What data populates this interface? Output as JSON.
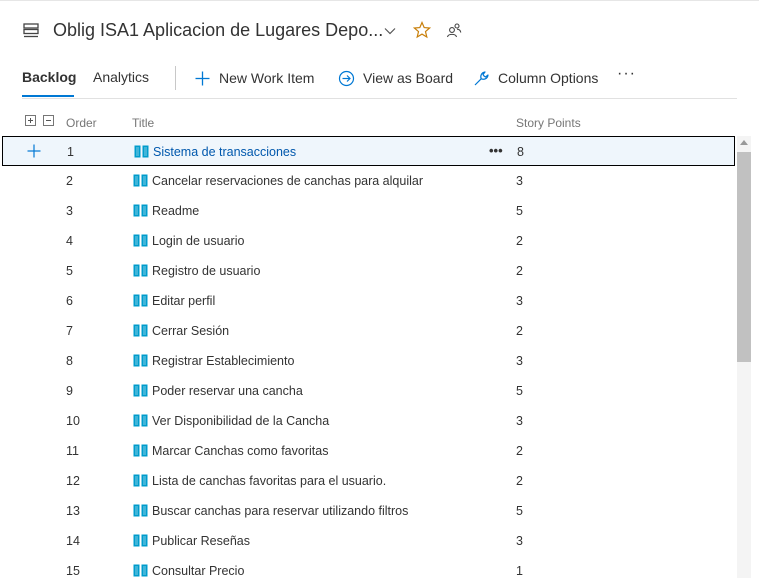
{
  "header": {
    "title": "Oblig ISA1 Aplicacion de Lugares Depo...",
    "icons": [
      "backlog-list-icon",
      "chevron-down-icon",
      "favorite-star-icon",
      "team-members-icon"
    ]
  },
  "toolbar": {
    "tabs": [
      {
        "label": "Backlog",
        "active": true
      },
      {
        "label": "Analytics",
        "active": false
      }
    ],
    "actions": [
      {
        "label": "New Work Item",
        "icon": "plus-icon"
      },
      {
        "label": "View as Board",
        "icon": "arrow-circle-icon"
      },
      {
        "label": "Column Options",
        "icon": "wrench-icon"
      }
    ],
    "more": "···"
  },
  "columns": {
    "order": "Order",
    "title": "Title",
    "points": "Story Points"
  },
  "rows": [
    {
      "order": "1",
      "title": "Sistema de transacciones",
      "points": "8",
      "selected": true
    },
    {
      "order": "2",
      "title": "Cancelar reservaciones de canchas para alquilar",
      "points": "3"
    },
    {
      "order": "3",
      "title": "Readme",
      "points": "5"
    },
    {
      "order": "4",
      "title": "Login de usuario",
      "points": "2"
    },
    {
      "order": "5",
      "title": "Registro de usuario",
      "points": "2"
    },
    {
      "order": "6",
      "title": "Editar perfil",
      "points": "3"
    },
    {
      "order": "7",
      "title": "Cerrar Sesión",
      "points": "2"
    },
    {
      "order": "8",
      "title": "Registrar Establecimiento",
      "points": "3"
    },
    {
      "order": "9",
      "title": "Poder reservar una cancha",
      "points": "5"
    },
    {
      "order": "10",
      "title": "Ver Disponibilidad de la Cancha",
      "points": "3"
    },
    {
      "order": "11",
      "title": "Marcar Canchas como favoritas",
      "points": "2"
    },
    {
      "order": "12",
      "title": "Lista de canchas favoritas para el usuario.",
      "points": "2"
    },
    {
      "order": "13",
      "title": "Buscar canchas para reservar utilizando filtros",
      "points": "5"
    },
    {
      "order": "14",
      "title": "Publicar Reseñas",
      "points": "3"
    },
    {
      "order": "15",
      "title": "Consultar Precio",
      "points": "1"
    }
  ],
  "row_more": "•••",
  "colors": {
    "accent": "#0078d4",
    "work_item_icon": "#009ccc",
    "star": "#c87f0a",
    "selected_row": "#eff6fc"
  }
}
